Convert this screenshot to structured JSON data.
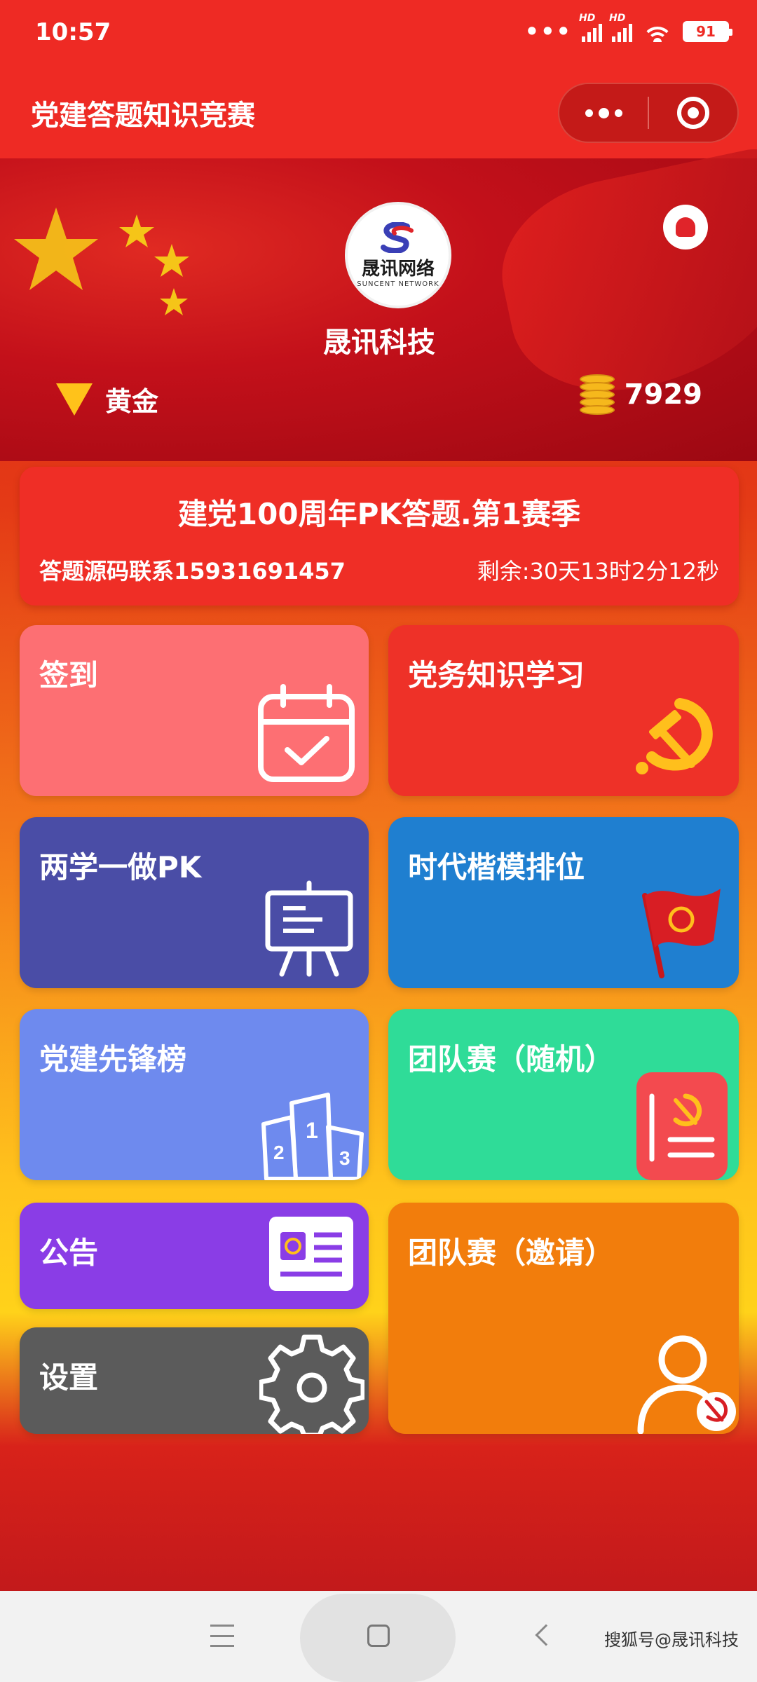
{
  "status_bar": {
    "time": "10:57",
    "battery": "91"
  },
  "header": {
    "title": "党建答题知识竞赛"
  },
  "profile": {
    "org_name": "晟讯科技",
    "logo_cn": "晟讯网络",
    "logo_en": "SUNCENT NETWORK",
    "rank": "黄金",
    "coins": "7929"
  },
  "contest": {
    "title": "建党100周年PK答题.第1赛季",
    "contact": "答题源码联系15931691457",
    "remaining": "剩余:30天13时2分12秒"
  },
  "tiles": {
    "sign_in": "签到",
    "party_study": "党务知识学习",
    "pk": "两学一做PK",
    "model_rank": "时代楷模排位",
    "vanguard": "党建先锋榜",
    "team_random": "团队赛（随机）",
    "notice": "公告",
    "settings": "设置",
    "team_invite": "团队赛（邀请）"
  },
  "watermark": "搜狐号@晟讯科技",
  "colors": {
    "primary_red": "#ee2a24",
    "sign_in": "#fd6f73",
    "party_study": "#ee3128",
    "pk": "#4a4da6",
    "model_rank": "#1f7fd0",
    "vanguard": "#6e8aee",
    "team_random": "#2fdc98",
    "notice": "#8a3de6",
    "settings": "#5b5b5b",
    "team_invite": "#f27d0c",
    "gold": "#ffc21a"
  }
}
